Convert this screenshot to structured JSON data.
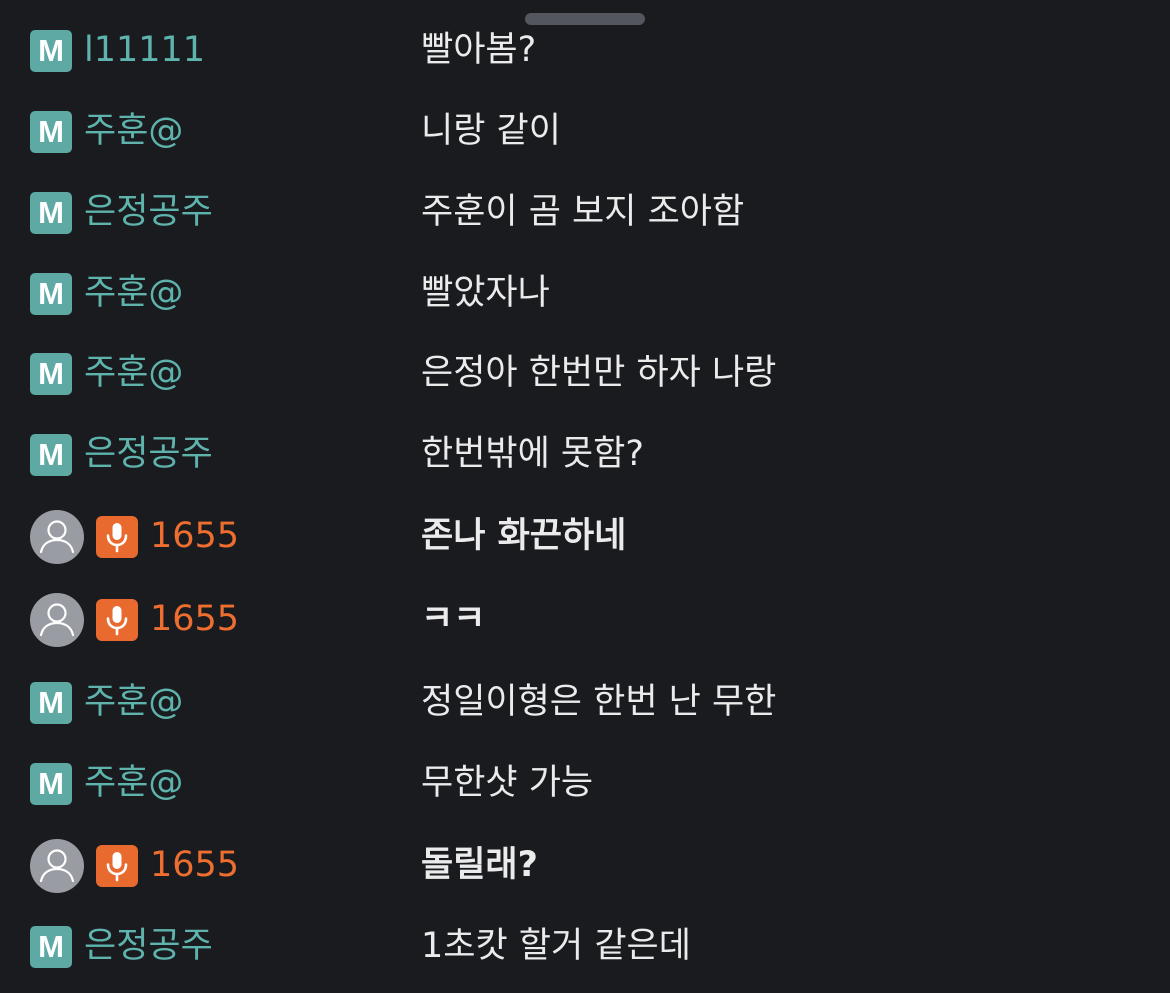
{
  "colors": {
    "background": "#1a1b1f",
    "manager_badge": "#5fa9a5",
    "manager_nick": "#5fb3ad",
    "speaker_badge": "#e86a2e",
    "speaker_nick": "#ee6e30",
    "message_text": "#ebebec"
  },
  "chat": {
    "messages": [
      {
        "type": "manager",
        "badge": "M",
        "nick": "l11111",
        "text": "빨아봄?"
      },
      {
        "type": "manager",
        "badge": "M",
        "nick": "주훈@",
        "text": "니랑 같이"
      },
      {
        "type": "manager",
        "badge": "M",
        "nick": "은정공주",
        "text": "주훈이 곰 보지 조아함"
      },
      {
        "type": "manager",
        "badge": "M",
        "nick": "주훈@",
        "text": "빨았자나"
      },
      {
        "type": "manager",
        "badge": "M",
        "nick": "주훈@",
        "text": "은정아 한번만 하자 나랑"
      },
      {
        "type": "manager",
        "badge": "M",
        "nick": "은정공주",
        "text": "한번밖에 못함?"
      },
      {
        "type": "speaker",
        "icon": "microphone-icon",
        "nick": "1655",
        "text": "존나 화끈하네"
      },
      {
        "type": "speaker",
        "icon": "microphone-icon",
        "nick": "1655",
        "text": "ㅋㅋ"
      },
      {
        "type": "manager",
        "badge": "M",
        "nick": "주훈@",
        "text": "정일이형은 한번 난 무한"
      },
      {
        "type": "manager",
        "badge": "M",
        "nick": "주훈@",
        "text": "무한샷 가능"
      },
      {
        "type": "speaker",
        "icon": "microphone-icon",
        "nick": "1655",
        "text": "돌릴래?"
      },
      {
        "type": "manager",
        "badge": "M",
        "nick": "은정공주",
        "text": "1초캇 할거 같은데"
      }
    ]
  }
}
